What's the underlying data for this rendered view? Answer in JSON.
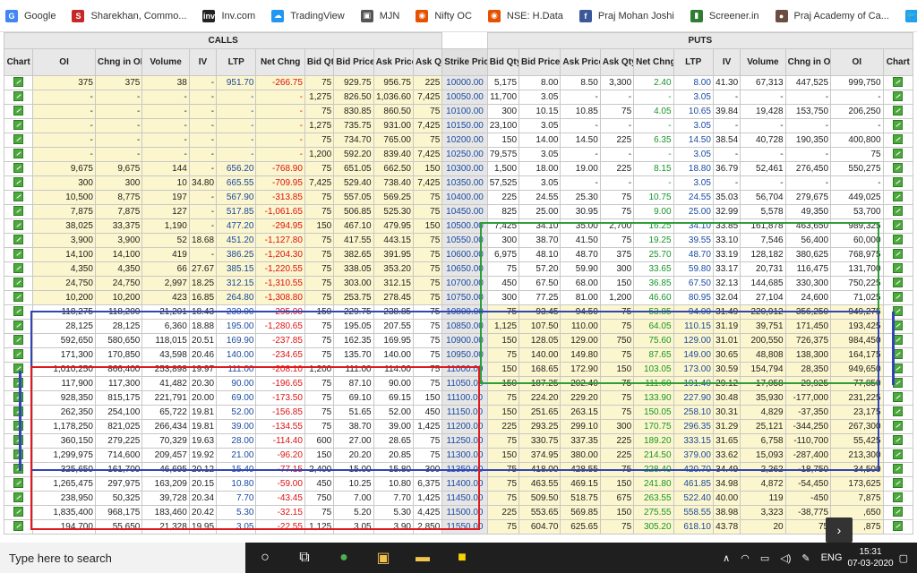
{
  "bookmarks": [
    {
      "label": "Google",
      "icon": "G",
      "color": "#4285f4"
    },
    {
      "label": "Sharekhan, Commo...",
      "icon": "S",
      "color": "#c62828"
    },
    {
      "label": "Inv.com",
      "icon": "inv",
      "color": "#222222"
    },
    {
      "label": "TradingView",
      "icon": "☁",
      "color": "#2196f3"
    },
    {
      "label": "MJN",
      "icon": "▣",
      "color": "#555555"
    },
    {
      "label": "Nifty OC",
      "icon": "◉",
      "color": "#e65100"
    },
    {
      "label": "NSE: H.Data",
      "icon": "◉",
      "color": "#e65100"
    },
    {
      "label": "Praj Mohan Joshi",
      "icon": "f",
      "color": "#3b5998"
    },
    {
      "label": "Screener.in",
      "icon": "▮",
      "color": "#2e7d32"
    },
    {
      "label": "Praj Academy of Ca...",
      "icon": "●",
      "color": "#6d4c41"
    },
    {
      "label": "MJ Twitter",
      "icon": "🐦",
      "color": "#1da1f2"
    }
  ],
  "groups": {
    "calls": "CALLS",
    "puts": "PUTS"
  },
  "headers": [
    "Chart",
    "OI",
    "Chng in OI",
    "Volume",
    "IV",
    "LTP",
    "Net Chng",
    "Bid Qty",
    "Bid Price",
    "Ask Price",
    "Ask Qty",
    "Strike Price",
    "Bid Qty",
    "Bid Price",
    "Ask Price",
    "Ask Qty",
    "Net Chng",
    "LTP",
    "IV",
    "Volume",
    "Chng in OI",
    "OI",
    "Chart"
  ],
  "rows": [
    [
      "375",
      "375",
      "38",
      "-",
      "951.70",
      "-266.75",
      "75",
      "929.75",
      "956.75",
      "225",
      "10000.00",
      "5,175",
      "8.00",
      "8.50",
      "3,300",
      "2.40",
      "8.00",
      "41.30",
      "67,313",
      "447,525",
      "999,750"
    ],
    [
      "-",
      "-",
      "-",
      "-",
      "-",
      "-",
      "1,275",
      "826.50",
      "1,036.60",
      "7,425",
      "10050.00",
      "11,700",
      "3.05",
      "-",
      "-",
      "-",
      "3.05",
      "-",
      "-",
      "-",
      "-"
    ],
    [
      "-",
      "-",
      "-",
      "-",
      "-",
      "-",
      "75",
      "830.85",
      "860.50",
      "75",
      "10100.00",
      "300",
      "10.15",
      "10.85",
      "75",
      "4.05",
      "10.65",
      "39.84",
      "19,428",
      "153,750",
      "206,250"
    ],
    [
      "-",
      "-",
      "-",
      "-",
      "-",
      "-",
      "1,275",
      "735.75",
      "931.00",
      "7,425",
      "10150.00",
      "23,100",
      "3.05",
      "-",
      "-",
      "-",
      "3.05",
      "-",
      "-",
      "-",
      "-"
    ],
    [
      "-",
      "-",
      "-",
      "-",
      "-",
      "-",
      "75",
      "734.70",
      "765.00",
      "75",
      "10200.00",
      "150",
      "14.00",
      "14.50",
      "225",
      "6.35",
      "14.50",
      "38.54",
      "40,728",
      "190,350",
      "400,800"
    ],
    [
      "-",
      "-",
      "-",
      "-",
      "-",
      "-",
      "1,200",
      "592.20",
      "839.40",
      "7,425",
      "10250.00",
      "79,575",
      "3.05",
      "-",
      "-",
      "-",
      "3.05",
      "-",
      "-",
      "-",
      "75"
    ],
    [
      "9,675",
      "9,675",
      "144",
      "-",
      "656.20",
      "-768.90",
      "75",
      "651.05",
      "662.50",
      "150",
      "10300.00",
      "1,500",
      "18.00",
      "19.00",
      "225",
      "8.15",
      "18.80",
      "36.79",
      "52,461",
      "276,450",
      "550,275"
    ],
    [
      "300",
      "300",
      "10",
      "34.80",
      "665.55",
      "-709.95",
      "7,425",
      "529.40",
      "738.40",
      "7,425",
      "10350.00",
      "57,525",
      "3.05",
      "-",
      "-",
      "-",
      "3.05",
      "-",
      "-",
      "-",
      "-"
    ],
    [
      "10,500",
      "8,775",
      "197",
      "-",
      "567.90",
      "-313.85",
      "75",
      "557.05",
      "569.25",
      "75",
      "10400.00",
      "225",
      "24.55",
      "25.30",
      "75",
      "10.75",
      "24.55",
      "35.03",
      "56,704",
      "279,675",
      "449,025"
    ],
    [
      "7,875",
      "7,875",
      "127",
      "-",
      "517.85",
      "-1,061.65",
      "75",
      "506.85",
      "525.30",
      "75",
      "10450.00",
      "825",
      "25.00",
      "30.95",
      "75",
      "9.00",
      "25.00",
      "32.99",
      "5,578",
      "49,350",
      "53,700"
    ],
    [
      "38,025",
      "33,375",
      "1,190",
      "-",
      "477.20",
      "-294.95",
      "150",
      "467.10",
      "479.95",
      "150",
      "10500.00",
      "7,425",
      "34.10",
      "35.00",
      "2,700",
      "16.25",
      "34.10",
      "33.85",
      "161,878",
      "463,650",
      "989,325"
    ],
    [
      "3,900",
      "3,900",
      "52",
      "18.68",
      "451.20",
      "-1,127.80",
      "75",
      "417.55",
      "443.15",
      "75",
      "10550.00",
      "300",
      "38.70",
      "41.50",
      "75",
      "19.25",
      "39.55",
      "33.10",
      "7,546",
      "56,400",
      "60,000"
    ],
    [
      "14,100",
      "14,100",
      "419",
      "-",
      "386.25",
      "-1,204.30",
      "75",
      "382.65",
      "391.95",
      "75",
      "10600.00",
      "6,975",
      "48.10",
      "48.70",
      "375",
      "25.70",
      "48.70",
      "33.19",
      "128,182",
      "380,625",
      "768,975"
    ],
    [
      "4,350",
      "4,350",
      "66",
      "27.67",
      "385.15",
      "-1,220.55",
      "75",
      "338.05",
      "353.20",
      "75",
      "10650.00",
      "75",
      "57.20",
      "59.90",
      "300",
      "33.65",
      "59.80",
      "33.17",
      "20,731",
      "116,475",
      "131,700"
    ],
    [
      "24,750",
      "24,750",
      "2,997",
      "18.25",
      "312.15",
      "-1,310.55",
      "75",
      "303.00",
      "312.15",
      "75",
      "10700.00",
      "450",
      "67.50",
      "68.00",
      "150",
      "36.85",
      "67.50",
      "32.13",
      "144,685",
      "330,300",
      "750,225"
    ],
    [
      "10,200",
      "10,200",
      "423",
      "16.85",
      "264.80",
      "-1,308.80",
      "75",
      "253.75",
      "278.45",
      "75",
      "10750.00",
      "300",
      "77.25",
      "81.00",
      "1,200",
      "46.60",
      "80.95",
      "32.04",
      "27,104",
      "24,600",
      "71,025"
    ],
    [
      "118,275",
      "118,200",
      "21,201",
      "18.43",
      "230.00",
      "-295.00",
      "150",
      "229.75",
      "238.85",
      "75",
      "10800.00",
      "75",
      "93.45",
      "94.50",
      "75",
      "53.85",
      "94.00",
      "31.49",
      "220,912",
      "356,250",
      "949,275"
    ],
    [
      "28,125",
      "28,125",
      "6,360",
      "18.88",
      "195.00",
      "-1,280.65",
      "75",
      "195.05",
      "207.55",
      "75",
      "10850.00",
      "1,125",
      "107.50",
      "110.00",
      "75",
      "64.05",
      "110.15",
      "31.19",
      "39,751",
      "171,450",
      "193,425"
    ],
    [
      "592,650",
      "580,650",
      "118,015",
      "20.51",
      "169.90",
      "-237.85",
      "75",
      "162.35",
      "169.95",
      "75",
      "10900.00",
      "150",
      "128.05",
      "129.00",
      "750",
      "75.60",
      "129.00",
      "31.01",
      "200,550",
      "726,375",
      "984,450"
    ],
    [
      "171,300",
      "170,850",
      "43,598",
      "20.46",
      "140.00",
      "-234.65",
      "75",
      "135.70",
      "140.00",
      "75",
      "10950.00",
      "75",
      "140.00",
      "149.80",
      "75",
      "87.65",
      "149.00",
      "30.65",
      "48,808",
      "138,300",
      "164,175"
    ],
    [
      "1,010,250",
      "866,400",
      "253,898",
      "19.97",
      "111.00",
      "-208.10",
      "1,200",
      "111.00",
      "114.00",
      "75",
      "11000.00",
      "150",
      "168.65",
      "172.90",
      "150",
      "103.05",
      "173.00",
      "30.59",
      "154,794",
      "28,350",
      "949,650"
    ],
    [
      "117,900",
      "117,300",
      "41,482",
      "20.30",
      "90.00",
      "-196.65",
      "75",
      "87.10",
      "90.00",
      "75",
      "11050.00",
      "150",
      "187.25",
      "202.40",
      "75",
      "111.60",
      "191.40",
      "29.12",
      "17,058",
      "29,925",
      "77,850"
    ],
    [
      "928,350",
      "815,175",
      "221,791",
      "20.00",
      "69.00",
      "-173.50",
      "75",
      "69.10",
      "69.15",
      "150",
      "11100.00",
      "75",
      "224.20",
      "229.20",
      "75",
      "133.90",
      "227.90",
      "30.48",
      "35,930",
      "-177,000",
      "231,225"
    ],
    [
      "262,350",
      "254,100",
      "65,722",
      "19.81",
      "52.00",
      "-156.85",
      "75",
      "51.65",
      "52.00",
      "450",
      "11150.00",
      "150",
      "251.65",
      "263.15",
      "75",
      "150.05",
      "258.10",
      "30.31",
      "4,829",
      "-37,350",
      "23,175"
    ],
    [
      "1,178,250",
      "821,025",
      "266,434",
      "19.81",
      "39.00",
      "-134.55",
      "75",
      "38.70",
      "39.00",
      "1,425",
      "11200.00",
      "225",
      "293.25",
      "299.10",
      "300",
      "170.75",
      "296.35",
      "31.29",
      "25,121",
      "-344,250",
      "267,300"
    ],
    [
      "360,150",
      "279,225",
      "70,329",
      "19.63",
      "28.00",
      "-114.40",
      "600",
      "27.00",
      "28.65",
      "75",
      "11250.00",
      "75",
      "330.75",
      "337.35",
      "225",
      "189.20",
      "333.15",
      "31.65",
      "6,758",
      "-110,700",
      "55,425"
    ],
    [
      "1,299,975",
      "714,600",
      "209,457",
      "19.92",
      "21.00",
      "-96.20",
      "150",
      "20.20",
      "20.85",
      "75",
      "11300.00",
      "150",
      "374.95",
      "380.00",
      "225",
      "214.50",
      "379.00",
      "33.62",
      "15,093",
      "-287,400",
      "213,300"
    ],
    [
      "325,650",
      "161,700",
      "46,695",
      "20.12",
      "15.40",
      "-77.15",
      "2,400",
      "15.00",
      "15.80",
      "300",
      "11350.00",
      "75",
      "418.00",
      "428.55",
      "75",
      "228.40",
      "420.70",
      "34.49",
      "2,262",
      "-18,750",
      "34,500"
    ],
    [
      "1,265,475",
      "297,975",
      "163,209",
      "20.15",
      "10.80",
      "-59.00",
      "450",
      "10.25",
      "10.80",
      "6,375",
      "11400.00",
      "75",
      "463.55",
      "469.15",
      "150",
      "241.80",
      "461.85",
      "34.98",
      "4,872",
      "-54,450",
      "173,625"
    ],
    [
      "238,950",
      "50,325",
      "39,728",
      "20.34",
      "7.70",
      "-43.45",
      "750",
      "7.00",
      "7.70",
      "1,425",
      "11450.00",
      "75",
      "509.50",
      "518.75",
      "675",
      "263.55",
      "522.40",
      "40.00",
      "119",
      "-450",
      "7,875"
    ],
    [
      "1,835,400",
      "968,175",
      "183,460",
      "20.42",
      "5.30",
      "-32.15",
      "75",
      "5.20",
      "5.30",
      "4,425",
      "11500.00",
      "225",
      "553.65",
      "569.85",
      "150",
      "275.55",
      "558.55",
      "38.98",
      "3,323",
      "-38,775",
      ",650"
    ],
    [
      "194,700",
      "55,650",
      "21,328",
      "19.95",
      "3.05",
      "-22.55",
      "1,125",
      "3.05",
      "3.90",
      "2,850",
      "11550.00",
      "75",
      "604.70",
      "625.65",
      "75",
      "305.20",
      "618.10",
      "43.78",
      "20",
      "75",
      ",875"
    ]
  ],
  "itm_call_rows_count": 16,
  "taskbar": {
    "search_placeholder": "Type here to search",
    "lang": "ENG",
    "time": "15:31",
    "date": "07-03-2020"
  },
  "colors": {
    "itm": "#fbf6cd",
    "green_box": "#2e9e3a",
    "blue_box": "#3146b5",
    "red_box": "#e0191f",
    "neg": "#d11111",
    "pos": "#17952a"
  }
}
